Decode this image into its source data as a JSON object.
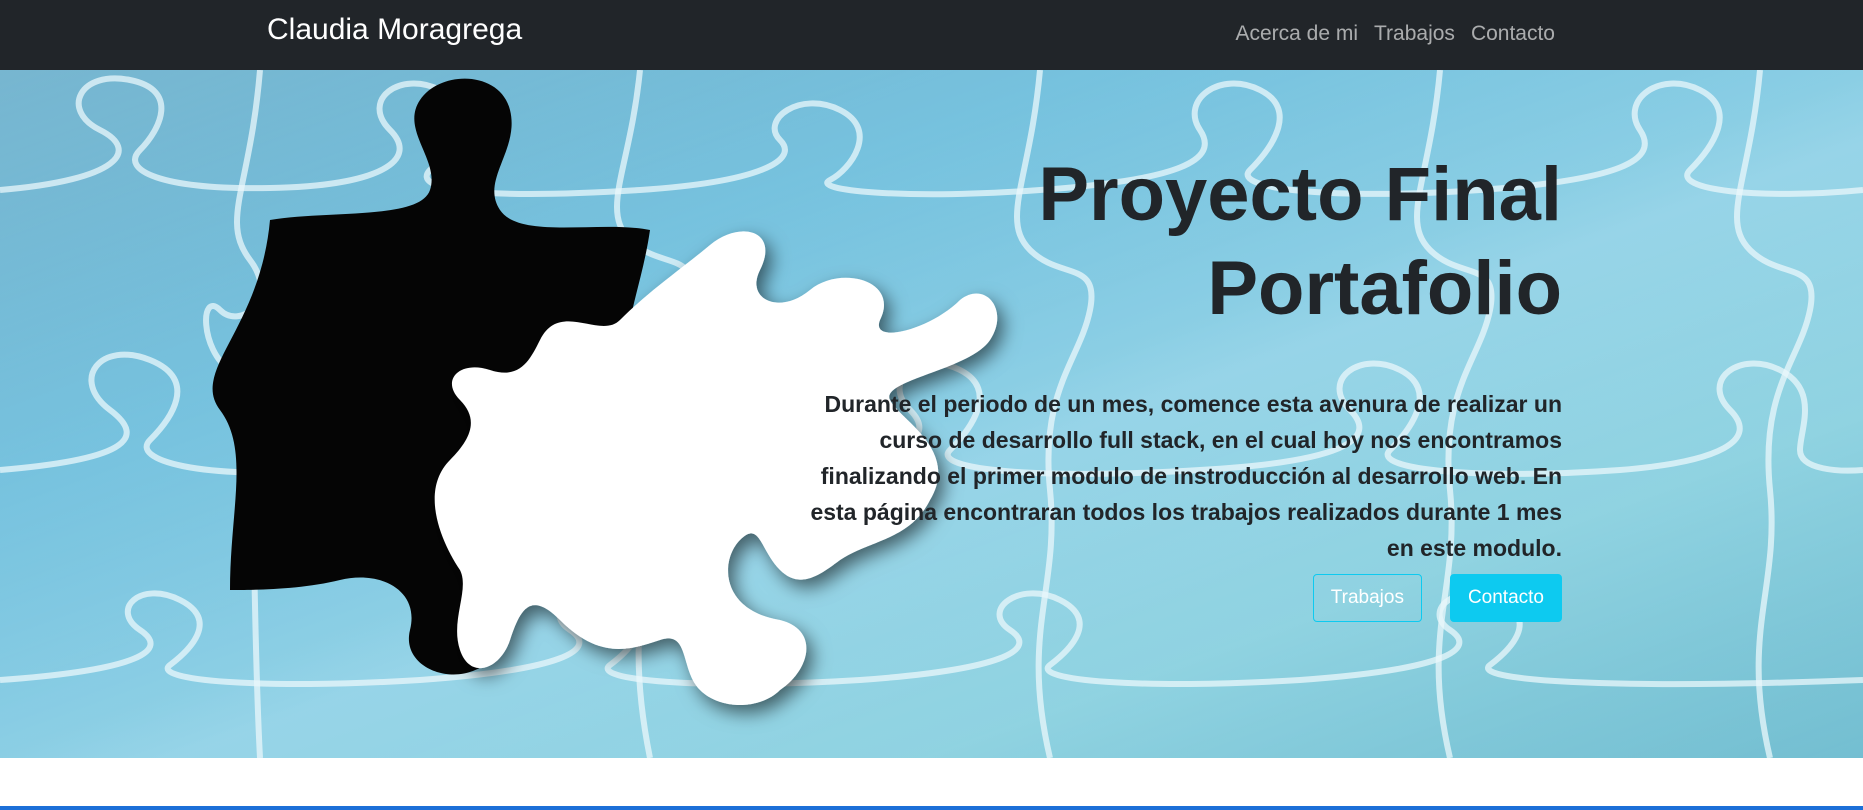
{
  "navbar": {
    "brand": "Claudia Moragrega",
    "links": [
      "Acerca de mi",
      "Trabajos",
      "Contacto"
    ]
  },
  "hero": {
    "title": "Proyecto Final Portafolio",
    "text": "Durante el periodo de un mes, comence esta avenura de realizar un curso de desarrollo full stack, en el cual hoy nos encontramos finalizando el primer modulo de instroducción al desarrollo web. En esta página encontraran todos los trabajos realizados durante 1 mes en este modulo.",
    "buttons": {
      "works": "Trabajos",
      "contact": "Contacto"
    },
    "image": "puzzle-pieces-background"
  },
  "colors": {
    "navbar_bg": "#212529",
    "accent": "#0dcaf0",
    "bottom_line": "#1c6fd8"
  }
}
